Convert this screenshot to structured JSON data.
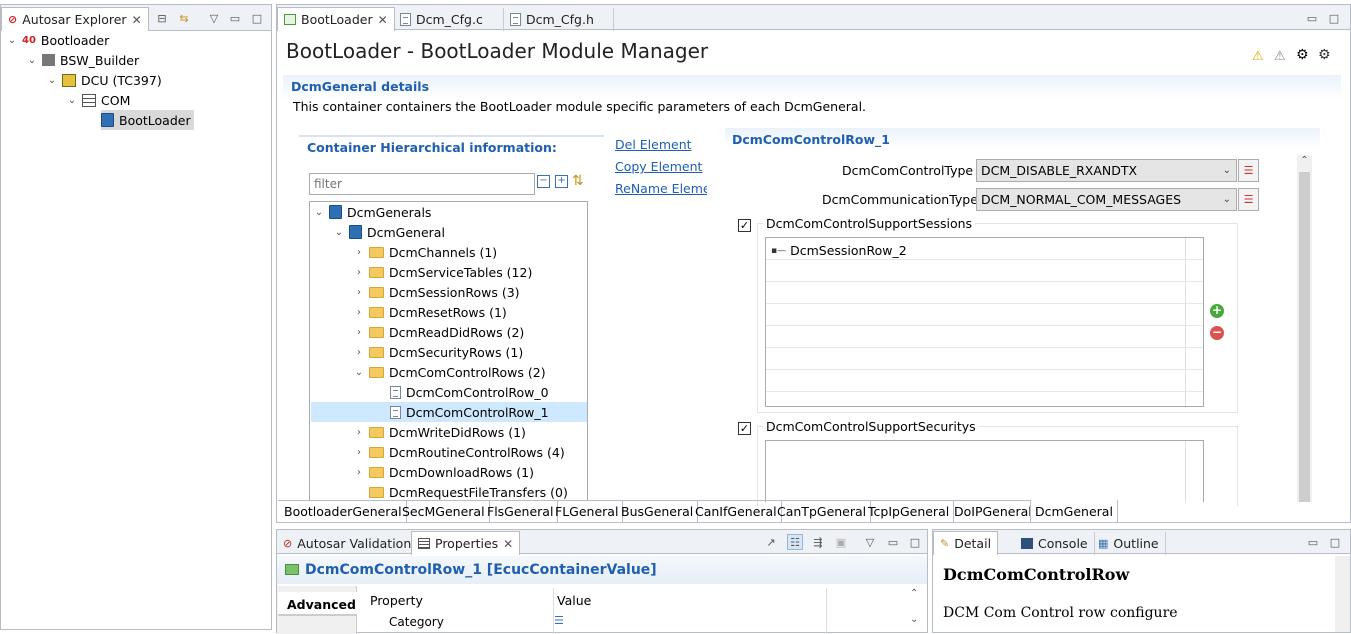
{
  "explorer": {
    "tab_label": "Autosar Explorer",
    "tree": [
      {
        "label": "Bootloader",
        "icon": "autosar-root-icon"
      },
      {
        "label": "BSW_Builder",
        "icon": "bsw-builder-icon"
      },
      {
        "label": "DCU (TC397)",
        "icon": "ecu-icon"
      },
      {
        "label": "COM",
        "icon": "list-icon"
      },
      {
        "label": "BootLoader",
        "icon": "module-icon"
      }
    ]
  },
  "editor": {
    "tabs": [
      "BootLoader",
      "Dcm_Cfg.c",
      "Dcm_Cfg.h"
    ],
    "title": "BootLoader - BootLoader Module Manager",
    "details_title": "DcmGeneral details",
    "details_desc": "This container containers the BootLoader module specific parameters of each DcmGeneral.",
    "hier_title": "Container Hierarchical information:",
    "filter_placeholder": "filter",
    "actions": [
      "Del Element",
      "Copy Element",
      "ReName Elemer"
    ],
    "tree": [
      {
        "label": "DcmGenerals"
      },
      {
        "label": "DcmGeneral"
      },
      {
        "label": "DcmChannels (1)"
      },
      {
        "label": "DcmServiceTables (12)"
      },
      {
        "label": "DcmSessionRows (3)"
      },
      {
        "label": "DcmResetRows (1)"
      },
      {
        "label": "DcmReadDidRows (2)"
      },
      {
        "label": "DcmSecurityRows (1)"
      },
      {
        "label": "DcmComControlRows (2)"
      },
      {
        "label": "DcmComControlRow_0"
      },
      {
        "label": "DcmComControlRow_1"
      },
      {
        "label": "DcmWriteDidRows (1)"
      },
      {
        "label": "DcmRoutineControlRows (4)"
      },
      {
        "label": "DcmDownloadRows (1)"
      },
      {
        "label": "DcmRequestFileTransfers (0)"
      }
    ],
    "form": {
      "section_title": "DcmComControlRow_1",
      "control_type_label": "DcmComControlType :",
      "control_type_value": "DCM_DISABLE_RXANDTX",
      "comm_type_label": "DcmCommunicationType :",
      "comm_type_value": "DCM_NORMAL_COM_MESSAGES",
      "sessions_label": "DcmComControlSupportSessions",
      "session_item": "DcmSessionRow_2",
      "securitys_label": "DcmComControlSupportSecuritys"
    },
    "bottom_tabs": [
      "BootloaderGeneral",
      "SecMGeneral",
      "FlsGeneral",
      "FLGeneral",
      "BusGeneral",
      "CanIfGeneral",
      "CanTpGeneral",
      "TcpIpGeneral",
      "DoIPGeneral",
      "DcmGeneral"
    ]
  },
  "properties": {
    "tabs": [
      "Autosar Validation",
      "Properties"
    ],
    "title": "DcmComControlRow_1 [EcucContainerValue]",
    "side_tab": "Advanced",
    "col_property": "Property",
    "col_value": "Value",
    "row_label": "Category"
  },
  "detail": {
    "tabs": [
      "Detail",
      "Console",
      "Outline"
    ],
    "heading": "DcmComControlRow",
    "text": "DCM Com Control row configure"
  },
  "colors": {
    "accent": "#1f5fb0",
    "chrome": "#eef1f6",
    "selection": "#cde8ff"
  }
}
